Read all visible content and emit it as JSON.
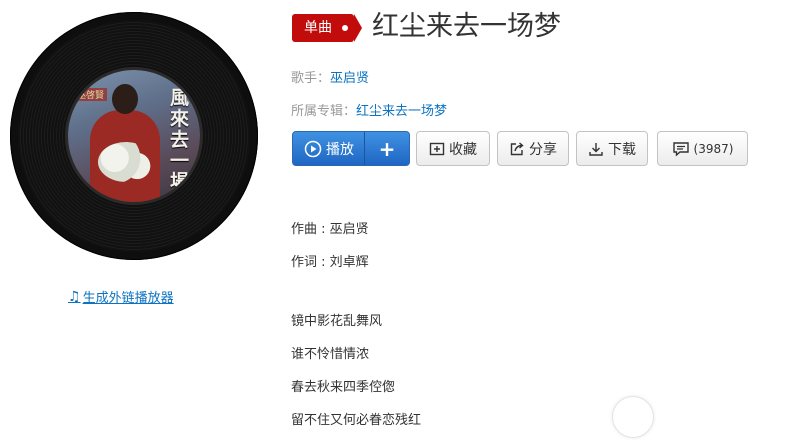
{
  "cover": {
    "tag_text": "巫啓賢",
    "title_text": "風來去一場夢"
  },
  "player_link": {
    "label": "生成外链播放器",
    "icon": "music-note-icon"
  },
  "song": {
    "badge": "单曲",
    "title": "红尘来去一场梦",
    "artist_label": "歌手：",
    "artist": "巫启贤",
    "album_label": "所属专辑：",
    "album": "红尘来去一场梦"
  },
  "actions": {
    "play_label": "播放",
    "add_label": "+",
    "collect_label": "收藏",
    "share_label": "分享",
    "download_label": "下载",
    "comment_count": "(3987)"
  },
  "lyrics": {
    "composer": "作曲 : 巫启贤",
    "lyricist": "作词 : 刘卓辉",
    "lines": [
      "镜中影花乱舞风",
      "谁不怜惜情浓",
      "春去秋来四季倥偬",
      "留不住又何必眷恋残红"
    ]
  },
  "colors": {
    "accent_red": "#c20c0c",
    "link_blue": "#0c73c2",
    "play_blue": "#2a7bd3"
  }
}
